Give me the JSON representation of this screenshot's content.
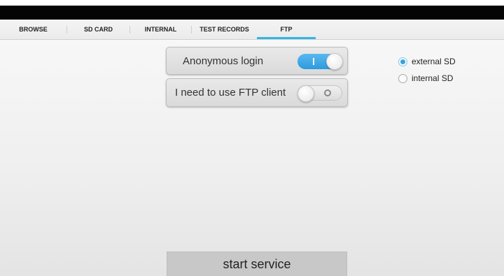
{
  "tabs": [
    {
      "label": "BROWSE",
      "active": false
    },
    {
      "label": "SD CARD",
      "active": false
    },
    {
      "label": "INTERNAL",
      "active": false
    },
    {
      "label": "TEST RECORDS",
      "active": false
    },
    {
      "label": "FTP",
      "active": true
    }
  ],
  "options": {
    "anonymous_login": {
      "label": "Anonymous login",
      "enabled": true
    },
    "ftp_client": {
      "label": "I need to use FTP client",
      "enabled": false
    }
  },
  "storage": {
    "selected": "external SD",
    "options": [
      "external SD",
      "internal SD"
    ]
  },
  "start_button": {
    "label": "start service"
  },
  "colors": {
    "accent": "#33b5e5",
    "toggle_on": "#3aa3e3",
    "status_bar": "#050505"
  }
}
